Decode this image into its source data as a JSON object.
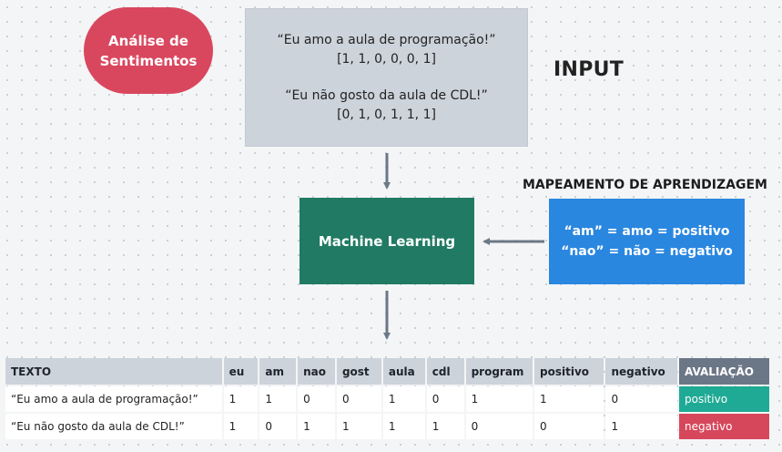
{
  "badge": {
    "line1": "Análise de",
    "line2": "Sentimentos",
    "color": "#d9475e"
  },
  "input": {
    "sentence1": "“Eu amo a aula de programação!”",
    "vector1": "[1, 1, 0, 0, 0, 1]",
    "sentence2": "“Eu não gosto da aula de CDL!”",
    "vector2": "[0, 1, 0, 1, 1, 1]",
    "title": "INPUT"
  },
  "model": {
    "label": "Machine Learning",
    "color": "#217a63"
  },
  "mapping": {
    "title": "MAPEAMENTO DE APRENDIZAGEM",
    "line1": "“am” = amo = positivo",
    "line2": "“nao” = não = negativo",
    "color": "#2a87e0"
  },
  "table": {
    "headers": [
      "TEXTO",
      "eu",
      "am",
      "nao",
      "gost",
      "aula",
      "cdl",
      "program",
      "positivo",
      "negativo",
      "AVALIAÇÃO"
    ],
    "rows": [
      [
        "“Eu amo a aula de programação!”",
        "1",
        "1",
        "0",
        "0",
        "1",
        "0",
        "1",
        "1",
        "0",
        "positivo"
      ],
      [
        "“Eu não gosto da aula de CDL!”",
        "1",
        "0",
        "1",
        "1",
        "1",
        "1",
        "0",
        "0",
        "1",
        "negativo"
      ]
    ],
    "positive_color": "#1faa95",
    "negative_color": "#d6475c"
  }
}
